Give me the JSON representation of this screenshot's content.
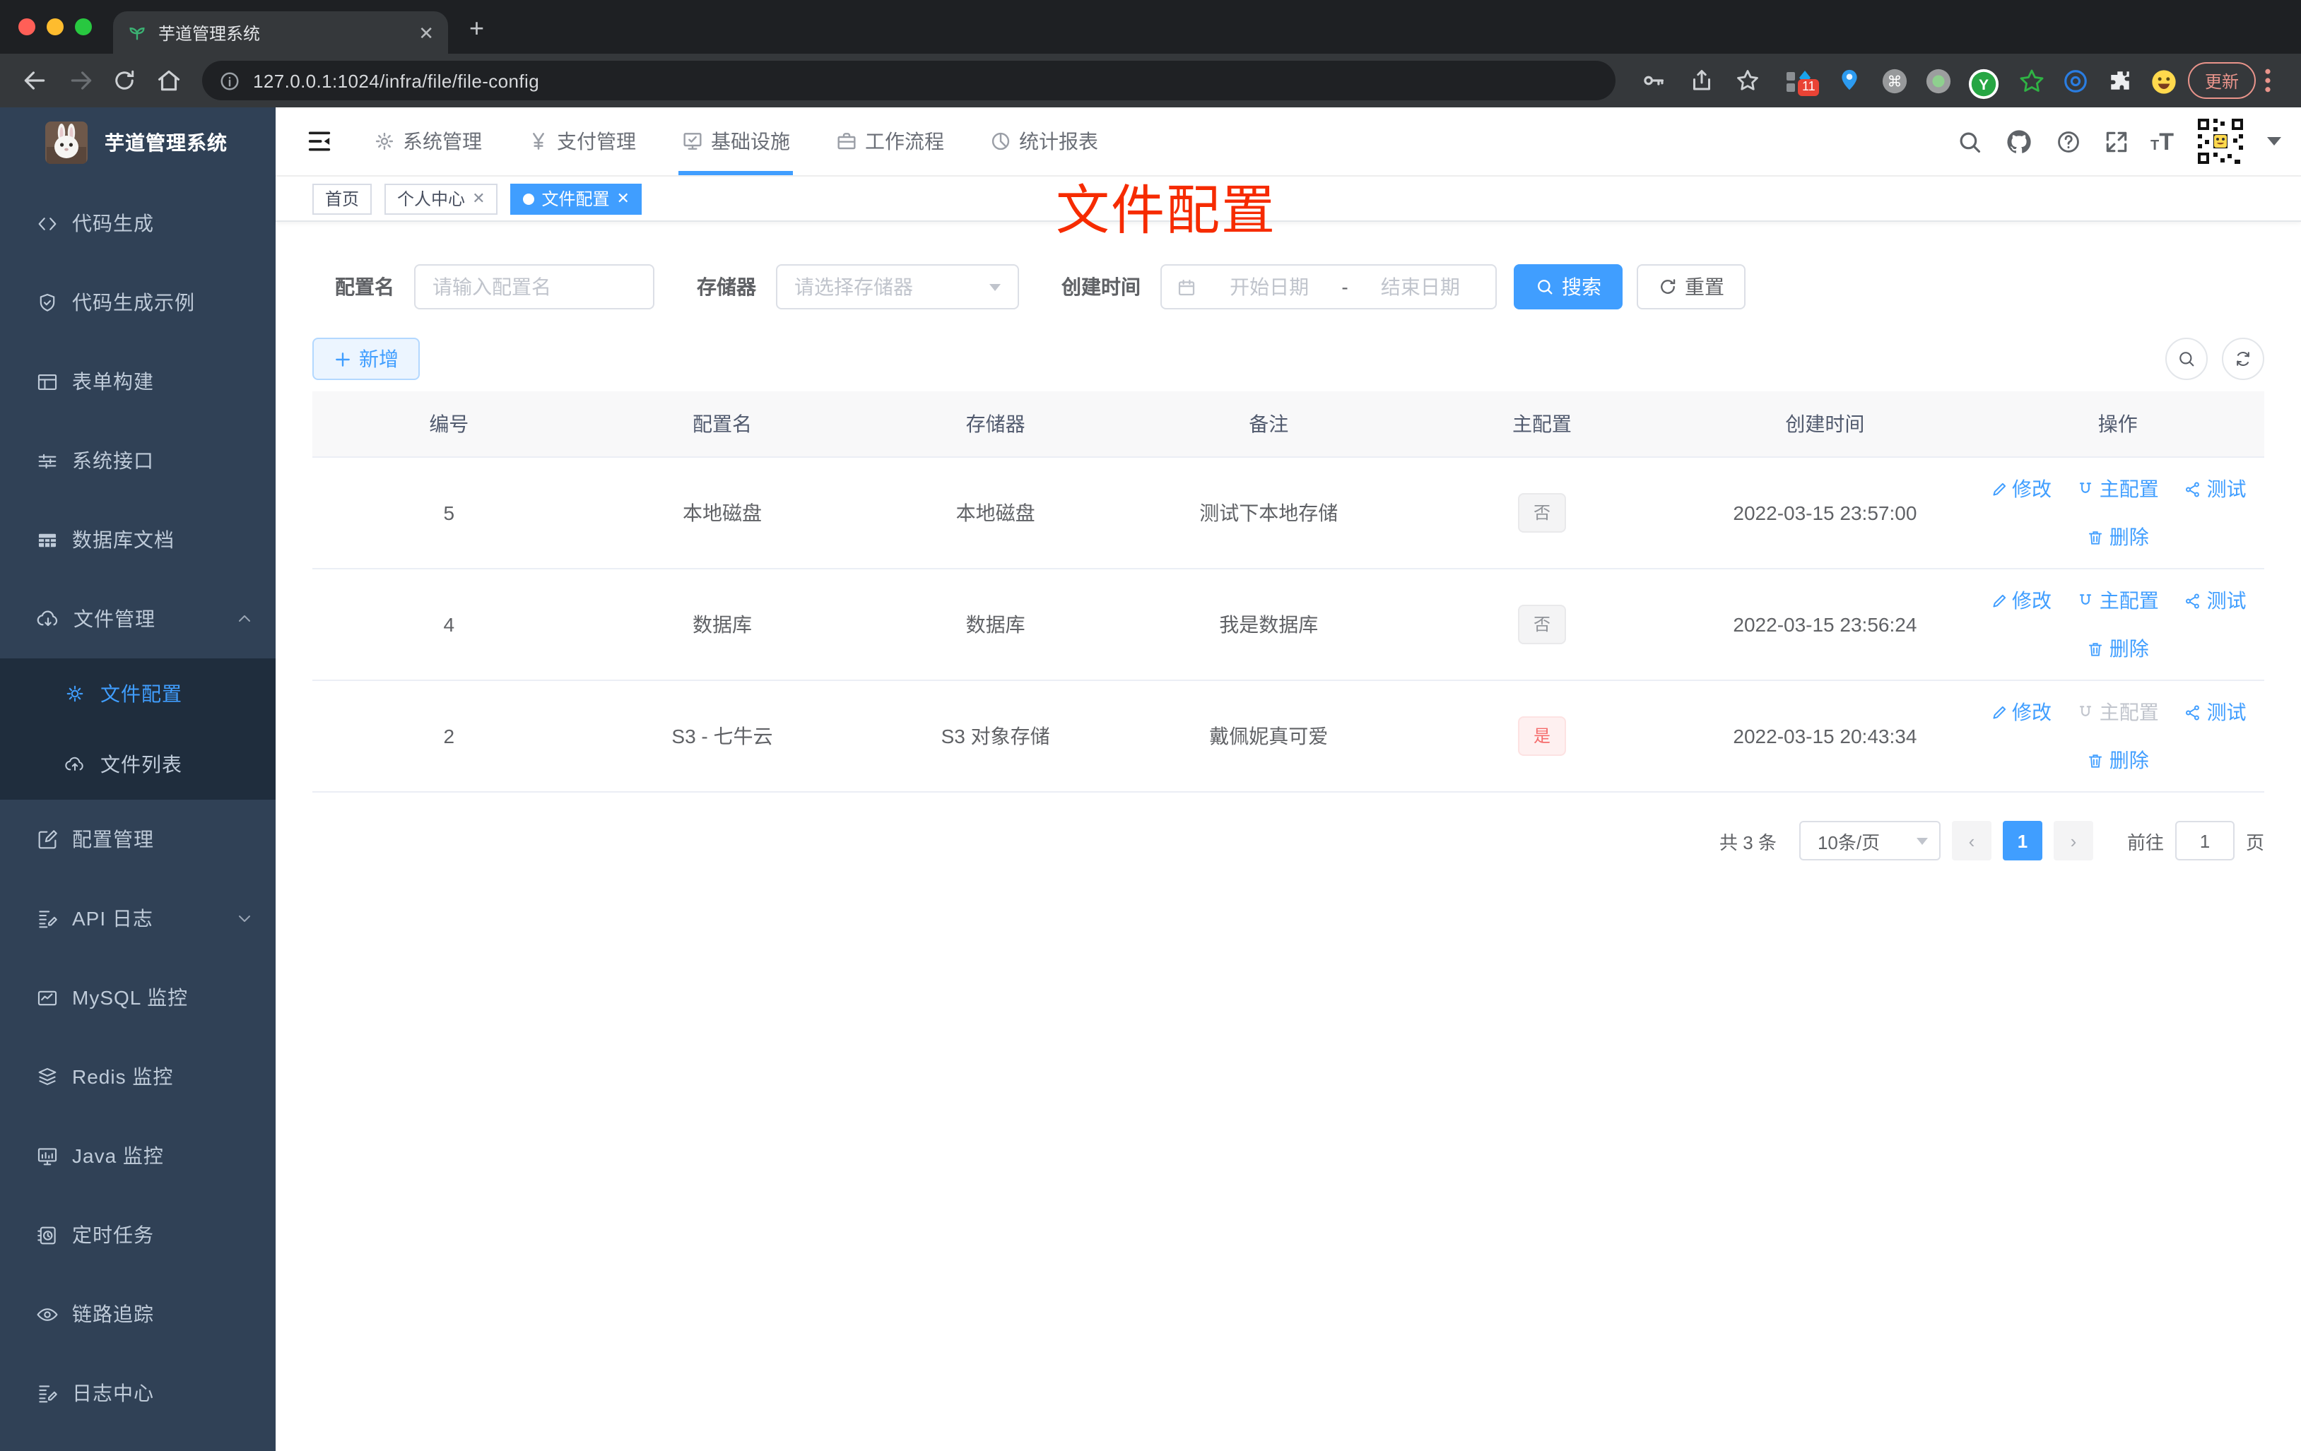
{
  "browser": {
    "tab_title": "芋道管理系统",
    "url": "127.0.0.1:1024/infra/file/file-config",
    "ext_badge": "11",
    "update_label": "更新"
  },
  "annotation": {
    "text": "文件配置",
    "color": "#f62b00"
  },
  "sidebar": {
    "logo_title": "芋道管理系统",
    "items": [
      {
        "icon": "code-icon",
        "label": "代码生成"
      },
      {
        "icon": "shield-check-icon",
        "label": "代码生成示例"
      },
      {
        "icon": "form-build-icon",
        "label": "表单构建"
      },
      {
        "icon": "sliders-icon",
        "label": "系统接口"
      },
      {
        "icon": "database-doc-icon",
        "label": "数据库文档"
      },
      {
        "icon": "cloud-download-icon",
        "label": "文件管理"
      }
    ],
    "submenu": [
      {
        "icon": "gear-icon",
        "label": "文件配置",
        "active": true
      },
      {
        "icon": "cloud-upload-icon",
        "label": "文件列表"
      }
    ],
    "items2": [
      {
        "icon": "edit-square-icon",
        "label": "配置管理"
      },
      {
        "icon": "api-log-icon",
        "label": "API 日志"
      },
      {
        "icon": "mysql-monitor-icon",
        "label": "MySQL 监控"
      },
      {
        "icon": "redis-monitor-icon",
        "label": "Redis 监控"
      },
      {
        "icon": "java-monitor-icon",
        "label": "Java 监控"
      },
      {
        "icon": "timer-task-icon",
        "label": "定时任务"
      },
      {
        "icon": "trace-eye-icon",
        "label": "链路追踪"
      },
      {
        "icon": "log-center-icon",
        "label": "日志中心"
      }
    ]
  },
  "topnav": {
    "items": [
      {
        "label": "系统管理"
      },
      {
        "label": "支付管理"
      },
      {
        "label": "基础设施"
      },
      {
        "label": "工作流程"
      },
      {
        "label": "统计报表"
      }
    ]
  },
  "tags": {
    "home": "首页",
    "profile": "个人中心",
    "active": "文件配置"
  },
  "filters": {
    "name_label": "配置名",
    "name_placeholder": "请输入配置名",
    "storage_label": "存储器",
    "storage_placeholder": "请选择存储器",
    "time_label": "创建时间",
    "start_placeholder": "开始日期",
    "separator": "-",
    "end_placeholder": "结束日期",
    "search_label": "搜索",
    "reset_label": "重置"
  },
  "actions_bar": {
    "add_label": "新增"
  },
  "table": {
    "headers": [
      "编号",
      "配置名",
      "存储器",
      "备注",
      "主配置",
      "创建时间",
      "操作"
    ],
    "action_labels": {
      "edit": "修改",
      "master": "主配置",
      "test": "测试",
      "delete": "删除"
    },
    "rows": [
      {
        "id": "5",
        "name": "本地磁盘",
        "storage": "本地磁盘",
        "remark": "测试下本地存储",
        "master": "否",
        "master_type": "info",
        "created": "2022-03-15 23:57:00"
      },
      {
        "id": "4",
        "name": "数据库",
        "storage": "数据库",
        "remark": "我是数据库",
        "master": "否",
        "master_type": "info",
        "created": "2022-03-15 23:56:24"
      },
      {
        "id": "2",
        "name": "S3 - 七牛云",
        "storage": "S3 对象存储",
        "remark": "戴佩妮真可爱",
        "master": "是",
        "master_type": "danger",
        "created": "2022-03-15 20:43:34"
      }
    ]
  },
  "pagination": {
    "total": "共 3 条",
    "page_size": "10条/页",
    "page": "1",
    "goto_label": "前往",
    "goto_value": "1",
    "unit_label": "页"
  },
  "colors": {
    "primary": "#409eff",
    "danger": "#f56c6c",
    "sidebar": "#304156"
  }
}
